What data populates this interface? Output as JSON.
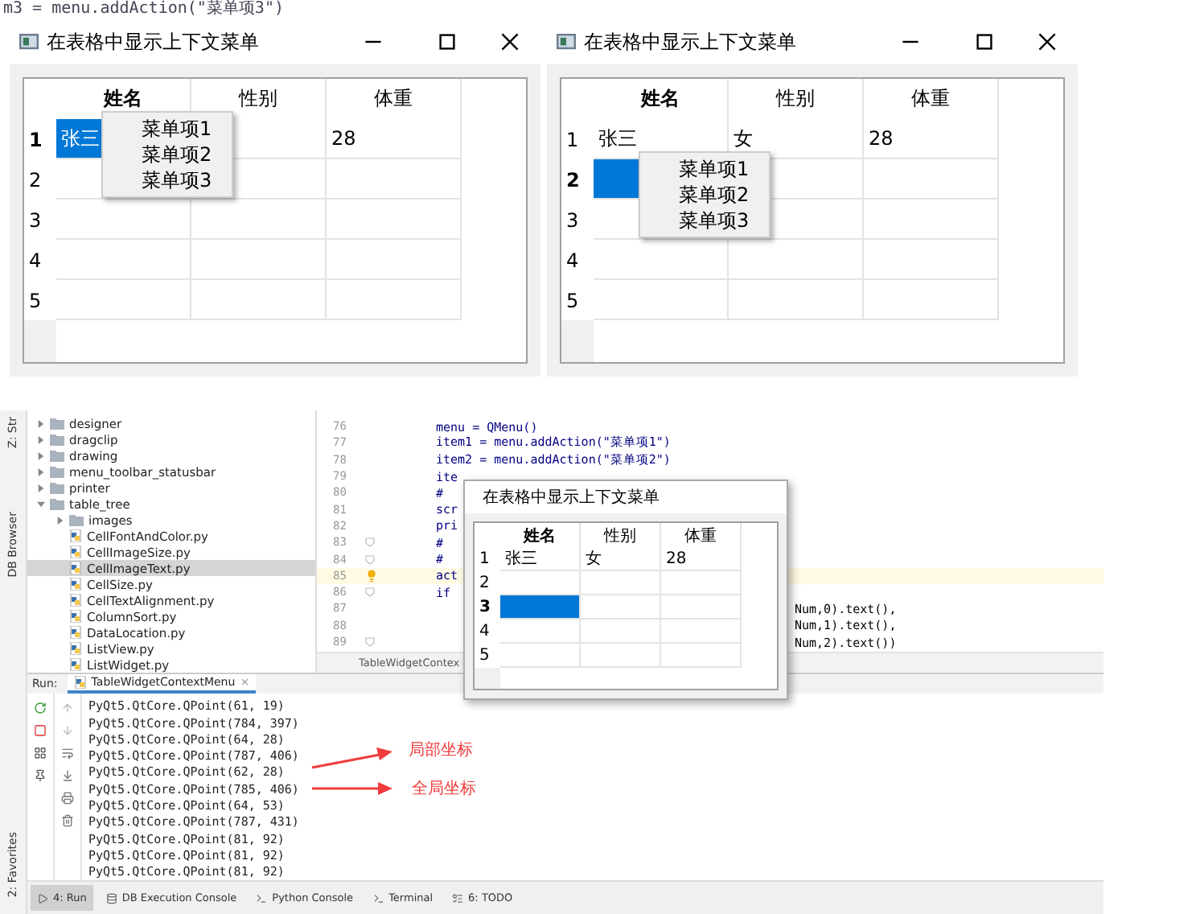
{
  "top_snippet": "m3 = menu.addAction(\"菜单项3\")",
  "windows": [
    {
      "title": "在表格中显示上下文菜单",
      "columns": [
        "姓名",
        "性别",
        "体重"
      ],
      "menu": [
        "菜单项1",
        "菜单项2",
        "菜单项3"
      ],
      "rows": [
        {
          "header": "1",
          "cells": [
            {
              "selected": true,
              "text": "张三"
            },
            {
              "selected": false
            },
            {
              "selected": false,
              "text": "28"
            }
          ]
        },
        {
          "header": "2",
          "cells": [
            {
              "selected": false
            },
            {
              "selected": false
            },
            {
              "selected": false
            }
          ]
        },
        {
          "header": "3",
          "cells": [
            {
              "selected": false
            },
            {
              "selected": false
            },
            {
              "selected": false
            }
          ]
        },
        {
          "header": "4",
          "cells": [
            {
              "selected": false
            },
            {
              "selected": false
            },
            {
              "selected": false
            }
          ]
        },
        {
          "header": "5",
          "cells": [
            {
              "selected": false
            },
            {
              "selected": false
            },
            {
              "selected": false
            }
          ]
        }
      ]
    },
    {
      "title": "在表格中显示上下文菜单",
      "columns": [
        "姓名",
        "性别",
        "体重"
      ],
      "menu": [
        "菜单项1",
        "菜单项2",
        "菜单项3"
      ],
      "rows": [
        {
          "header": "1",
          "cells": [
            {
              "selected": false,
              "text": "张三"
            },
            {
              "selected": false,
              "text": "女"
            },
            {
              "selected": false,
              "text": "28"
            }
          ]
        },
        {
          "header": "2",
          "cells": [
            {
              "selected": true
            },
            {
              "selected": false
            },
            {
              "selected": false
            }
          ]
        },
        {
          "header": "3",
          "cells": [
            {
              "selected": false
            },
            {
              "selected": false
            },
            {
              "selected": false
            }
          ]
        },
        {
          "header": "4",
          "cells": [
            {
              "selected": false
            },
            {
              "selected": false
            },
            {
              "selected": false
            }
          ]
        },
        {
          "header": "5",
          "cells": [
            {
              "selected": false
            },
            {
              "selected": false
            },
            {
              "selected": false
            }
          ]
        }
      ]
    }
  ],
  "ide": {
    "side_tabs": [
      "Z: Str",
      "DB Browser",
      "2: Favorites"
    ],
    "tree": [
      {
        "name": "designer",
        "kind": "folder",
        "expanded": false,
        "selected": false
      },
      {
        "name": "dragclip",
        "kind": "folder",
        "expanded": false,
        "selected": false
      },
      {
        "name": "drawing",
        "kind": "folder",
        "expanded": false,
        "selected": false
      },
      {
        "name": "menu_toolbar_statusbar",
        "kind": "folder",
        "expanded": false,
        "selected": false
      },
      {
        "name": "printer",
        "kind": "folder",
        "expanded": false,
        "selected": false
      },
      {
        "name": "table_tree",
        "kind": "folder",
        "expanded": true,
        "selected": false,
        "children": [
          {
            "name": "images",
            "kind": "folder",
            "expanded": false,
            "selected": false
          },
          {
            "name": "CellFontAndColor.py",
            "kind": "file",
            "selected": false
          },
          {
            "name": "CellImageSize.py",
            "kind": "file",
            "selected": false
          },
          {
            "name": "CellImageText.py",
            "kind": "file",
            "selected": true
          },
          {
            "name": "CellSize.py",
            "kind": "file",
            "selected": false
          },
          {
            "name": "CellTextAlignment.py",
            "kind": "file",
            "selected": false
          },
          {
            "name": "ColumnSort.py",
            "kind": "file",
            "selected": false
          },
          {
            "name": "DataLocation.py",
            "kind": "file",
            "selected": false
          },
          {
            "name": "ListView.py",
            "kind": "file",
            "selected": false
          },
          {
            "name": "ListWidget.py",
            "kind": "file",
            "selected": false
          }
        ]
      }
    ],
    "code_lines": [
      {
        "number": "76",
        "text": "menu = QMenu()",
        "current": false,
        "kind": "plain"
      },
      {
        "number": "77",
        "text": "item1 = menu.addAction(\"菜单项1\")",
        "current": false,
        "kind": "plain"
      },
      {
        "number": "78",
        "text": "item2 = menu.addAction(\"菜单项2\")",
        "current": false,
        "kind": "plain"
      },
      {
        "number": "79",
        "text": "ite",
        "current": false,
        "kind": "plain"
      },
      {
        "number": "80",
        "text": "#",
        "current": false,
        "kind": "plain"
      },
      {
        "number": "81",
        "text": "scr",
        "current": false,
        "kind": "plain"
      },
      {
        "number": "82",
        "text": "pri",
        "current": false,
        "kind": "plain"
      },
      {
        "number": "83",
        "text": "#",
        "current": false,
        "kind": "fold"
      },
      {
        "number": "84",
        "text": "#",
        "current": false,
        "kind": "fold"
      },
      {
        "number": "85",
        "text": "act",
        "current": true,
        "kind": "bulb"
      },
      {
        "number": "86",
        "text": "if",
        "current": false,
        "kind": "fold"
      },
      {
        "number": "87",
        "tail": "Num,0).text(),",
        "current": false,
        "kind": "plain"
      },
      {
        "number": "88",
        "tail": "Num,1).text(),",
        "current": false,
        "kind": "plain"
      },
      {
        "number": "89",
        "tail": "Num,2).text())",
        "current": false,
        "kind": "fold"
      }
    ],
    "editor_tab": "TableWidgetContex",
    "overlay_window": {
      "title": "在表格中显示上下文菜单",
      "columns": [
        "姓名",
        "性别",
        "体重"
      ],
      "rows": [
        {
          "header": "1",
          "cells": [
            {
              "selected": false,
              "text": "张三"
            },
            {
              "selected": false,
              "text": "女"
            },
            {
              "selected": false,
              "text": "28"
            }
          ]
        },
        {
          "header": "2",
          "cells": [
            {
              "selected": false
            },
            {
              "selected": false
            },
            {
              "selected": false
            }
          ]
        },
        {
          "header": "3",
          "cells": [
            {
              "selected": true
            },
            {
              "selected": false
            },
            {
              "selected": false
            }
          ]
        },
        {
          "header": "4",
          "cells": [
            {
              "selected": false
            },
            {
              "selected": false
            },
            {
              "selected": false
            }
          ]
        },
        {
          "header": "5",
          "cells": [
            {
              "selected": false
            },
            {
              "selected": false
            },
            {
              "selected": false
            }
          ]
        }
      ]
    },
    "run": {
      "label": "Run:",
      "tab": "TableWidgetContextMenu",
      "close": "×",
      "lines": [
        "PyQt5.QtCore.QPoint(61, 19)",
        "PyQt5.QtCore.QPoint(784, 397)",
        "PyQt5.QtCore.QPoint(64, 28)",
        "PyQt5.QtCore.QPoint(787, 406)",
        "PyQt5.QtCore.QPoint(62, 28)",
        "PyQt5.QtCore.QPoint(785, 406)",
        "PyQt5.QtCore.QPoint(64, 53)",
        "PyQt5.QtCore.QPoint(787, 431)",
        "PyQt5.QtCore.QPoint(81, 92)",
        "PyQt5.QtCore.QPoint(81, 92)",
        "PyQt5.QtCore.QPoint(81, 92)"
      ]
    },
    "annotations": [
      "局部坐标",
      "全局坐标"
    ],
    "toolbar": [
      {
        "label": "4: Run",
        "selected": true
      },
      {
        "label": "DB Execution Console",
        "selected": false
      },
      {
        "label": "Python Console",
        "selected": false
      },
      {
        "label": "Terminal",
        "selected": false
      },
      {
        "label": "6: TODO",
        "selected": false
      }
    ]
  }
}
